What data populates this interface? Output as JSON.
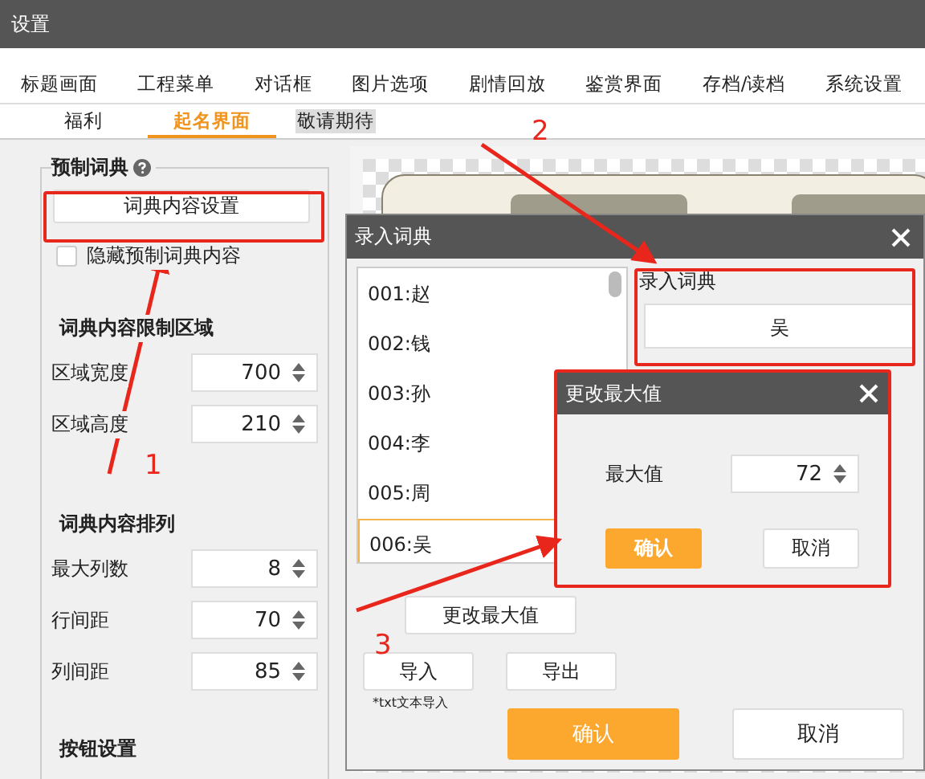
{
  "window": {
    "title": "设置"
  },
  "tabs": [
    {
      "label": "标题画面"
    },
    {
      "label": "工程菜单"
    },
    {
      "label": "对话框"
    },
    {
      "label": "图片选项"
    },
    {
      "label": "剧情回放"
    },
    {
      "label": "鉴赏界面"
    },
    {
      "label": "存档/读档"
    },
    {
      "label": "系统设置"
    }
  ],
  "subtabs": [
    {
      "label": "福利",
      "selected": false,
      "highlighted": false
    },
    {
      "label": "起名界面",
      "selected": true,
      "highlighted": false
    },
    {
      "label": "敬请期待",
      "selected": false,
      "highlighted": true
    }
  ],
  "left_panel": {
    "title": "预制词典",
    "button": "词典内容设置",
    "checkbox": {
      "label": "隐藏预制词典内容",
      "checked": false
    },
    "sections": [
      {
        "title": "词典内容限制区域",
        "fields": [
          {
            "label": "区域宽度",
            "value": "700"
          },
          {
            "label": "区域高度",
            "value": "210"
          }
        ]
      },
      {
        "title": "词典内容排列",
        "fields": [
          {
            "label": "最大列数",
            "value": "8"
          },
          {
            "label": "行间距",
            "value": "70"
          },
          {
            "label": "列间距",
            "value": "85"
          }
        ]
      },
      {
        "title": "按钮设置"
      }
    ]
  },
  "dictionary_dialog": {
    "title": "录入词典",
    "items": [
      {
        "label": "001:赵",
        "selected": false
      },
      {
        "label": "002:钱",
        "selected": false
      },
      {
        "label": "003:孙",
        "selected": false
      },
      {
        "label": "004:李",
        "selected": false
      },
      {
        "label": "005:周",
        "selected": false
      },
      {
        "label": "006:吴",
        "selected": true
      }
    ],
    "entry_label": "录入词典",
    "entry_value": "吴",
    "change_max": "更改最大值",
    "import": "导入",
    "export": "导出",
    "import_note": "*txt文本导入",
    "confirm": "确认",
    "cancel": "取消"
  },
  "max_dialog": {
    "title": "更改最大值",
    "label": "最大值",
    "value": "72",
    "confirm": "确认",
    "cancel": "取消"
  },
  "annotations": [
    {
      "label": "1"
    },
    {
      "label": "2"
    },
    {
      "label": "3"
    }
  ]
}
